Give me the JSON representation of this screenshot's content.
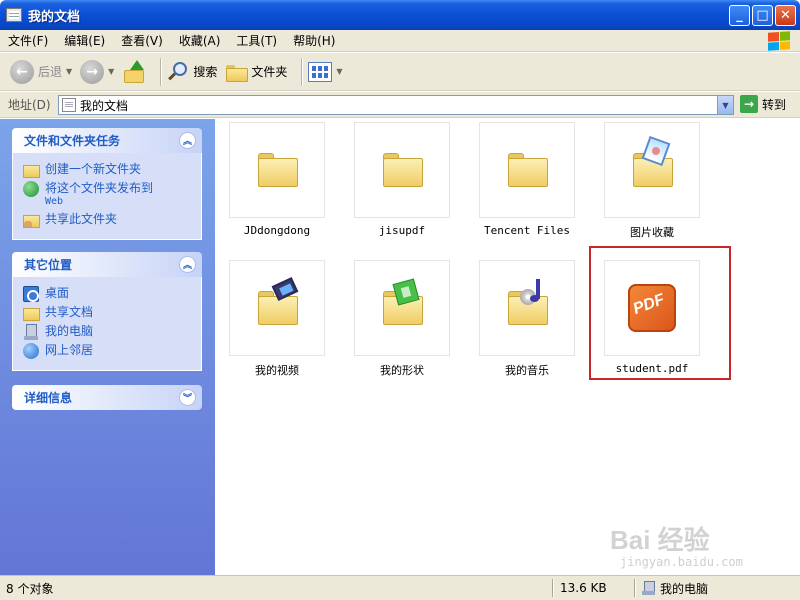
{
  "window": {
    "title": "我的文档"
  },
  "menu": [
    "文件(F)",
    "编辑(E)",
    "查看(V)",
    "收藏(A)",
    "工具(T)",
    "帮助(H)"
  ],
  "toolbar": {
    "back": "后退",
    "search": "搜索",
    "folders": "文件夹"
  },
  "address": {
    "label": "地址(D)",
    "value": "我的文档",
    "go": "转到"
  },
  "left": {
    "tasks_title": "文件和文件夹任务",
    "tasks": [
      {
        "label": "创建一个新文件夹",
        "icon": "new-folder-icon"
      },
      {
        "label": "将这个文件夹发布到",
        "sub": "Web",
        "icon": "publish-web-icon"
      },
      {
        "label": "共享此文件夹",
        "icon": "share-folder-icon"
      }
    ],
    "places_title": "其它位置",
    "places": [
      {
        "label": "桌面",
        "icon": "desktop-icon"
      },
      {
        "label": "共享文档",
        "icon": "folder-icon"
      },
      {
        "label": "我的电脑",
        "icon": "my-computer-icon"
      },
      {
        "label": "网上邻居",
        "icon": "network-icon"
      }
    ],
    "details_title": "详细信息"
  },
  "files": [
    {
      "name": "JDdongdong",
      "type": "folder"
    },
    {
      "name": "jisupdf",
      "type": "folder"
    },
    {
      "name": "Tencent Files",
      "type": "folder"
    },
    {
      "name": "图片收藏",
      "type": "pictures"
    },
    {
      "name": "我的视频",
      "type": "videos"
    },
    {
      "name": "我的形状",
      "type": "shapes"
    },
    {
      "name": "我的音乐",
      "type": "music"
    },
    {
      "name": "student.pdf",
      "type": "pdf"
    }
  ],
  "status": {
    "count": "8 个对象",
    "size": "13.6 KB",
    "location": "我的电脑"
  },
  "watermark": {
    "brand": "Bai 经验",
    "url": "jingyan.baidu.com"
  }
}
